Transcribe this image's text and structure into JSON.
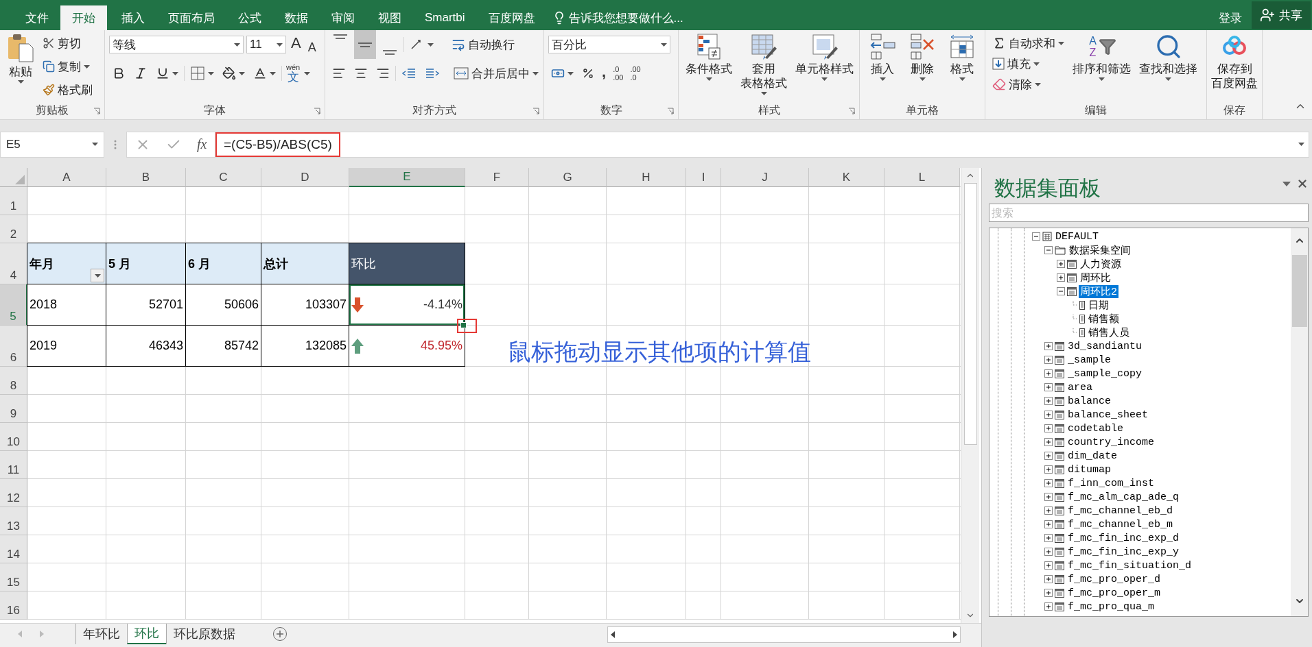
{
  "menu_bar": {
    "tabs": [
      {
        "label": "文件",
        "selected": false
      },
      {
        "label": "开始",
        "selected": true
      },
      {
        "label": "插入",
        "selected": false
      },
      {
        "label": "页面布局",
        "selected": false
      },
      {
        "label": "公式",
        "selected": false
      },
      {
        "label": "数据",
        "selected": false
      },
      {
        "label": "审阅",
        "selected": false
      },
      {
        "label": "视图",
        "selected": false
      },
      {
        "label": "Smartbi",
        "selected": false
      },
      {
        "label": "百度网盘",
        "selected": false
      }
    ],
    "tell_me": "告诉我您想要做什么...",
    "sign_in": "登录",
    "share": "共享"
  },
  "ribbon": {
    "clipboard": {
      "label": "剪贴板",
      "paste": "粘贴",
      "cut": "剪切",
      "copy": "复制",
      "format_painter": "格式刷"
    },
    "font": {
      "label": "字体",
      "font_name": "等线",
      "font_size": "11",
      "grow_font": "A",
      "shrink_font": "A",
      "phonetic": {
        "top": "wén",
        "bottom": "文"
      }
    },
    "alignment": {
      "label": "对齐方式",
      "vertical": [
        {
          "selected": false
        },
        {
          "selected": true
        },
        {
          "selected": false
        }
      ],
      "wrap_text": "自动换行",
      "merge_center": "合并后居中"
    },
    "number": {
      "label": "数字",
      "format": "百分比",
      "comma_style": ",",
      "increase_decimal": [
        ".0",
        ".00"
      ],
      "decrease_decimal": [
        ".00",
        ".0"
      ]
    },
    "styles": {
      "label": "样式",
      "buttons": [
        {
          "kind": "conditional",
          "lines": [
            "条件格式"
          ]
        },
        {
          "kind": "table",
          "lines": [
            "套用",
            "表格格式"
          ]
        },
        {
          "kind": "cell_style",
          "lines": [
            "单元格样式"
          ]
        }
      ]
    },
    "cells": {
      "label": "单元格",
      "buttons": [
        {
          "kind": "insert",
          "lines": [
            "插入"
          ]
        },
        {
          "kind": "delete",
          "lines": [
            "删除"
          ]
        },
        {
          "kind": "format",
          "lines": [
            "格式"
          ]
        }
      ]
    },
    "editing": {
      "label": "编辑",
      "autosum": "自动求和",
      "fill": "填充",
      "clear": "清除",
      "sort_letters": [
        "A",
        "Z"
      ],
      "sort_filter": "排序和筛选",
      "find_select": "查找和选择"
    },
    "save": {
      "label": "保存",
      "lines": [
        "保存到",
        "百度网盘"
      ]
    }
  },
  "formula_bar": {
    "name_box": "E5",
    "fx": "fx",
    "formula": "=(C5-B5)/ABS(C5)"
  },
  "sheet": {
    "columns": [
      {
        "label": "A",
        "selected": false
      },
      {
        "label": "B",
        "selected": false
      },
      {
        "label": "C",
        "selected": false
      },
      {
        "label": "D",
        "selected": false
      },
      {
        "label": "E",
        "selected": true
      },
      {
        "label": "F",
        "selected": false
      },
      {
        "label": "G",
        "selected": false
      },
      {
        "label": "H",
        "selected": false
      },
      {
        "label": "I",
        "selected": false
      },
      {
        "label": "J",
        "selected": false
      },
      {
        "label": "K",
        "selected": false
      },
      {
        "label": "L",
        "selected": false
      }
    ],
    "rows": [
      {
        "header": "1",
        "selected": false
      },
      {
        "header": "2",
        "selected": false
      },
      {
        "header": "4",
        "selected": false,
        "cells": [
          {
            "kind": "header",
            "text": "年月",
            "filter": true,
            "selected": false
          },
          {
            "kind": "header",
            "text": "5 月",
            "selected": false
          },
          {
            "kind": "header",
            "text": "6 月",
            "selected": false
          },
          {
            "kind": "header",
            "text": "总计",
            "selected": false
          },
          {
            "kind": "header_dark",
            "text": "环比",
            "selected": false
          }
        ]
      },
      {
        "header": "5",
        "selected": true,
        "cells": [
          {
            "kind": "text",
            "text": "2018",
            "selected": false
          },
          {
            "kind": "number",
            "text": "52701",
            "selected": false
          },
          {
            "kind": "number",
            "text": "50606",
            "selected": false
          },
          {
            "kind": "number",
            "text": "103307",
            "selected": false
          },
          {
            "kind": "trend",
            "trend_up": false,
            "text": "-4.14%",
            "color": "#333333",
            "selected": true
          }
        ]
      },
      {
        "header": "6",
        "selected": false,
        "cells": [
          {
            "kind": "text",
            "text": "2019",
            "selected": false
          },
          {
            "kind": "number",
            "text": "46343",
            "selected": false
          },
          {
            "kind": "number",
            "text": "85742",
            "selected": false
          },
          {
            "kind": "number",
            "text": "132085",
            "selected": false
          },
          {
            "kind": "trend",
            "trend_up": true,
            "text": "45.95%",
            "color": "#c0272d",
            "selected": false
          }
        ]
      },
      {
        "header": "8",
        "selected": false
      },
      {
        "header": "9",
        "selected": false
      },
      {
        "header": "10",
        "selected": false
      },
      {
        "header": "11",
        "selected": false
      },
      {
        "header": "12",
        "selected": false
      },
      {
        "header": "13",
        "selected": false
      },
      {
        "header": "14",
        "selected": false
      },
      {
        "header": "15",
        "selected": false
      },
      {
        "header": "16",
        "selected": false
      }
    ],
    "annotation": "鼠标拖动显示其他项的计算值",
    "tabs": [
      {
        "label": "年环比",
        "selected": false
      },
      {
        "label": "环比",
        "selected": true
      },
      {
        "label": "环比原数据",
        "selected": false
      }
    ]
  },
  "data_panel": {
    "title": "数据集面板",
    "search_placeholder": "搜索",
    "tree": [
      {
        "kind": "database",
        "label": "DEFAULT",
        "expanded": true,
        "selected": false,
        "children": [
          {
            "kind": "folder",
            "label": "数据采集空间",
            "expanded": true,
            "selected": false,
            "children": [
              {
                "kind": "table",
                "label": "人力资源",
                "expanded": false,
                "selected": false
              },
              {
                "kind": "table",
                "label": "周环比",
                "expanded": false,
                "selected": false
              },
              {
                "kind": "table",
                "label": "周环比2",
                "expanded": true,
                "selected": true,
                "children": [
                  {
                    "kind": "field",
                    "label": "日期",
                    "selected": false
                  },
                  {
                    "kind": "field",
                    "label": "销售额",
                    "selected": false
                  },
                  {
                    "kind": "field",
                    "label": "销售人员",
                    "selected": false
                  }
                ]
              }
            ]
          },
          {
            "kind": "table",
            "label": "3d_sandiantu",
            "expanded": false,
            "selected": false
          },
          {
            "kind": "table",
            "label": "_sample",
            "expanded": false,
            "selected": false
          },
          {
            "kind": "table",
            "label": "_sample_copy",
            "expanded": false,
            "selected": false
          },
          {
            "kind": "table",
            "label": "area",
            "expanded": false,
            "selected": false
          },
          {
            "kind": "table",
            "label": "balance",
            "expanded": false,
            "selected": false
          },
          {
            "kind": "table",
            "label": "balance_sheet",
            "expanded": false,
            "selected": false
          },
          {
            "kind": "table",
            "label": "codetable",
            "expanded": false,
            "selected": false
          },
          {
            "kind": "table",
            "label": "country_income",
            "expanded": false,
            "selected": false
          },
          {
            "kind": "table",
            "label": "dim_date",
            "expanded": false,
            "selected": false
          },
          {
            "kind": "table",
            "label": "ditumap",
            "expanded": false,
            "selected": false
          },
          {
            "kind": "table",
            "label": "f_inn_com_inst",
            "expanded": false,
            "selected": false
          },
          {
            "kind": "table",
            "label": "f_mc_alm_cap_ade_q",
            "expanded": false,
            "selected": false
          },
          {
            "kind": "table",
            "label": "f_mc_channel_eb_d",
            "expanded": false,
            "selected": false
          },
          {
            "kind": "table",
            "label": "f_mc_channel_eb_m",
            "expanded": false,
            "selected": false
          },
          {
            "kind": "table",
            "label": "f_mc_fin_inc_exp_d",
            "expanded": false,
            "selected": false
          },
          {
            "kind": "table",
            "label": "f_mc_fin_inc_exp_y",
            "expanded": false,
            "selected": false
          },
          {
            "kind": "table",
            "label": "f_mc_fin_situation_d",
            "expanded": false,
            "selected": false
          },
          {
            "kind": "table",
            "label": "f_mc_pro_oper_d",
            "expanded": false,
            "selected": false
          },
          {
            "kind": "table",
            "label": "f_mc_pro_oper_m",
            "expanded": false,
            "selected": false
          },
          {
            "kind": "table",
            "label": "f_mc_pro_qua_m",
            "expanded": false,
            "selected": false
          }
        ]
      }
    ]
  }
}
